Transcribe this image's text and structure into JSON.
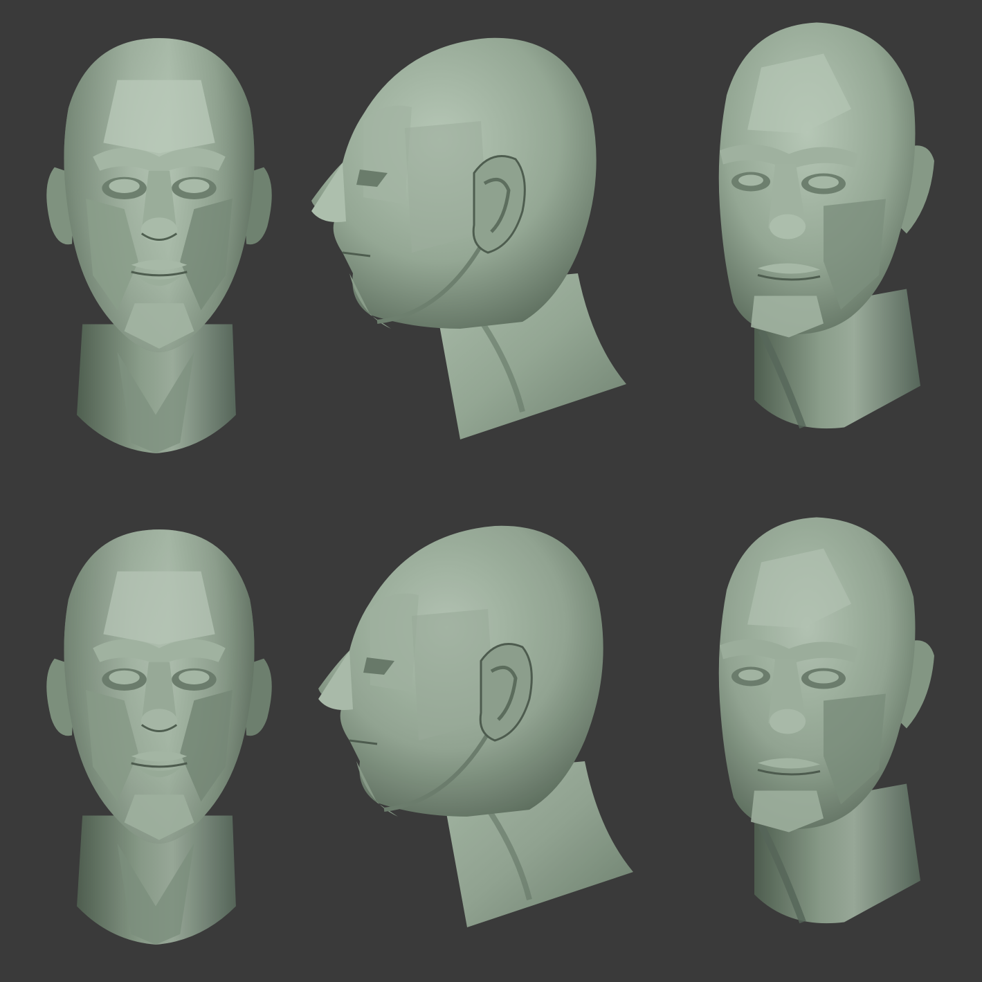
{
  "colors": {
    "background": "#3a3a3a",
    "clay_light": "#b9c9b9",
    "clay_mid": "#8fa28f",
    "clay_dark": "#5d6e5e",
    "clay_shadow": "#3f4a40"
  },
  "heads": [
    {
      "view": "front",
      "style": "detailed"
    },
    {
      "view": "profile-left",
      "style": "detailed"
    },
    {
      "view": "three-quarter",
      "style": "detailed"
    },
    {
      "view": "front",
      "style": "planar"
    },
    {
      "view": "profile-left",
      "style": "planar"
    },
    {
      "view": "three-quarter",
      "style": "planar"
    }
  ]
}
